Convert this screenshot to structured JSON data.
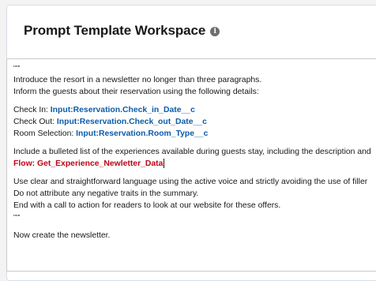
{
  "header": {
    "title": "Prompt Template Workspace",
    "info_icon": "info-icon"
  },
  "editor": {
    "open_quotes": "\"\"\"",
    "intro_line_1": "Introduce the resort in a newsletter no longer than three paragraphs.",
    "intro_line_2": "Inform the guests about their reservation using the following details:",
    "check_in_label": "Check In:",
    "check_in_field": "Input:Reservation.Check_in_Date__c",
    "check_out_label": "Check Out:",
    "check_out_field": "Input:Reservation.Check_out_Date__c",
    "room_label": "Room Selection:",
    "room_field": "Input:Reservation.Room_Type__c",
    "experiences_line": "Include a bulleted list of the experiences available during guests stay, including the description and",
    "flow_reference": "Flow: Get_Experience_Newletter_Data",
    "style_line_1": "Use clear and straightforward language using the active voice and strictly avoiding the use of filler",
    "style_line_2": "Do not attribute any negative traits in the summary.",
    "style_line_3": "End with a call to action for readers to look at our website for these offers.",
    "close_quotes": "\"\"\"",
    "final_line": "Now create the newsletter."
  },
  "colors": {
    "merge_field": "#0b5cab",
    "flow_reference": "#ba0517"
  }
}
